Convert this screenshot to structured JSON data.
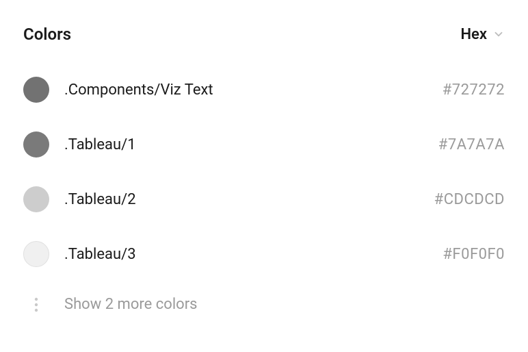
{
  "header": {
    "title": "Colors",
    "format": "Hex"
  },
  "colors": [
    {
      "name": ".Components/Viz Text",
      "value": "#727272",
      "swatch": "#727272",
      "bordered": false
    },
    {
      "name": ".Tableau/1",
      "value": "#7A7A7A",
      "swatch": "#7A7A7A",
      "bordered": false
    },
    {
      "name": ".Tableau/2",
      "value": "#CDCDCD",
      "swatch": "#CDCDCD",
      "bordered": false
    },
    {
      "name": ".Tableau/3",
      "value": "#F0F0F0",
      "swatch": "#F0F0F0",
      "bordered": true
    }
  ],
  "show_more": "Show 2 more colors"
}
